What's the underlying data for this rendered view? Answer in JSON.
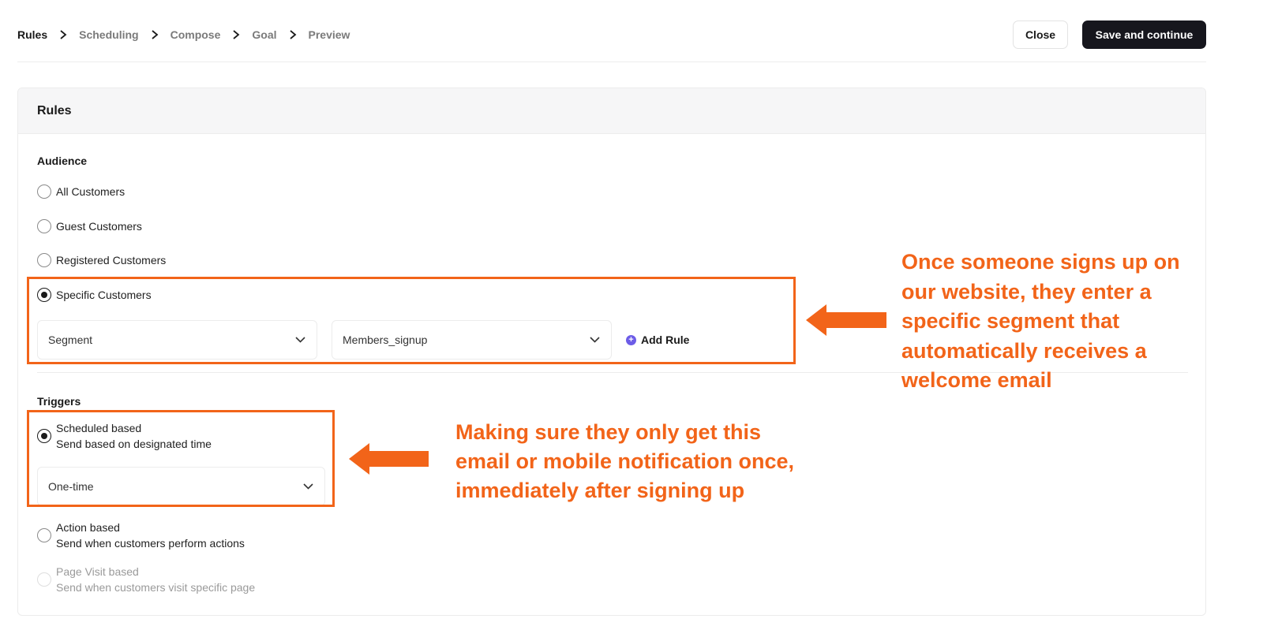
{
  "header": {
    "breadcrumb": [
      {
        "label": "Rules",
        "active": true
      },
      {
        "label": "Scheduling",
        "active": false
      },
      {
        "label": "Compose",
        "active": false
      },
      {
        "label": "Goal",
        "active": false
      },
      {
        "label": "Preview",
        "active": false
      }
    ],
    "close_label": "Close",
    "save_label": "Save and continue"
  },
  "card": {
    "title": "Rules",
    "audience": {
      "label": "Audience",
      "options": [
        {
          "label": "All Customers",
          "checked": false
        },
        {
          "label": "Guest Customers",
          "checked": false
        },
        {
          "label": "Registered Customers",
          "checked": false
        },
        {
          "label": "Specific Customers",
          "checked": true
        }
      ],
      "rule": {
        "field_value": "Segment",
        "segment_value": "Members_signup",
        "add_rule_label": "Add Rule"
      }
    },
    "triggers": {
      "label": "Triggers",
      "options": [
        {
          "title": "Scheduled based",
          "subtitle": "Send based on designated time",
          "checked": true,
          "disabled": false
        },
        {
          "title": "Action based",
          "subtitle": "Send when customers perform actions",
          "checked": false,
          "disabled": false
        },
        {
          "title": "Page Visit based",
          "subtitle": "Send when customers visit specific page",
          "checked": false,
          "disabled": true
        }
      ],
      "frequency_value": "One-time"
    }
  },
  "annotations": {
    "segment_note": [
      "Once someone signs up on",
      "our website, they enter a",
      "specific segment that",
      "automatically receives a",
      "welcome email"
    ],
    "trigger_note": [
      "Making sure they only get this",
      "email or mobile notification once,",
      "immediately after signing up"
    ]
  },
  "colors": {
    "annotation": "#f26419",
    "primary_button": "#16161d",
    "add_rule_icon": "#6c5ce7"
  }
}
